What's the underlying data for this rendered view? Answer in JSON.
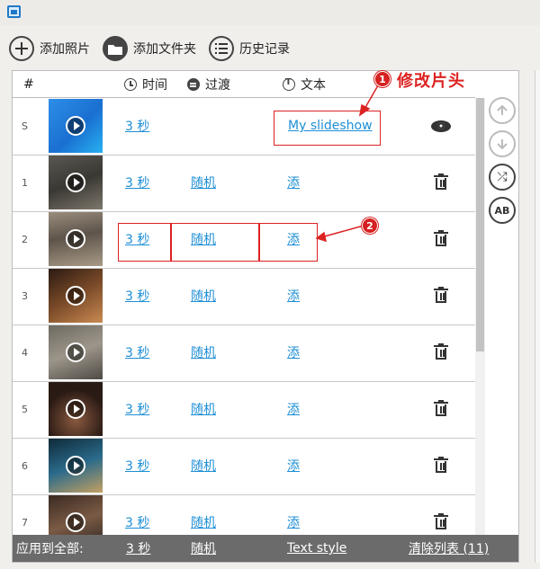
{
  "toolbar": {
    "add_photos": "添加照片",
    "add_folder": "添加文件夹",
    "history": "历史记录"
  },
  "table": {
    "headers": {
      "num": "#",
      "time": "时间",
      "transition": "过渡",
      "text": "文本"
    },
    "start_row": {
      "num": "S",
      "time": "3 秒",
      "text": "My slideshow"
    },
    "rows": [
      {
        "num": "1",
        "time": "3 秒",
        "transition": "随机",
        "text": "添"
      },
      {
        "num": "2",
        "time": "3 秒",
        "transition": "随机",
        "text": "添"
      },
      {
        "num": "3",
        "time": "3 秒",
        "transition": "随机",
        "text": "添"
      },
      {
        "num": "4",
        "time": "3 秒",
        "transition": "随机",
        "text": "添"
      },
      {
        "num": "5",
        "time": "3 秒",
        "transition": "随机",
        "text": "添"
      },
      {
        "num": "6",
        "time": "3 秒",
        "transition": "随机",
        "text": "添"
      },
      {
        "num": "7",
        "time": "3 秒",
        "transition": "随机",
        "text": "添"
      }
    ]
  },
  "footer": {
    "apply_all": "应用到全部:",
    "time": "3 秒",
    "transition": "随机",
    "text_style": "Text style",
    "clear_list": "清除列表 (11)"
  },
  "side_buttons": {
    "shuffle_label": "⤮",
    "ab_label": "AB"
  },
  "annotations": {
    "badge1": "1",
    "badge2": "2",
    "note1": "修改片头"
  },
  "icons": [
    "app-icon",
    "plus-icon",
    "folder-icon",
    "list-icon",
    "clock-icon",
    "layers-icon",
    "text-icon",
    "play-icon",
    "eye-icon",
    "trash-icon",
    "arrow-up-icon",
    "arrow-down-icon",
    "shuffle-icon",
    "ab-icon"
  ],
  "colors": {
    "link": "#1e8fd6",
    "footer_bg": "#6b6b6b",
    "annotation": "#dd2222"
  }
}
